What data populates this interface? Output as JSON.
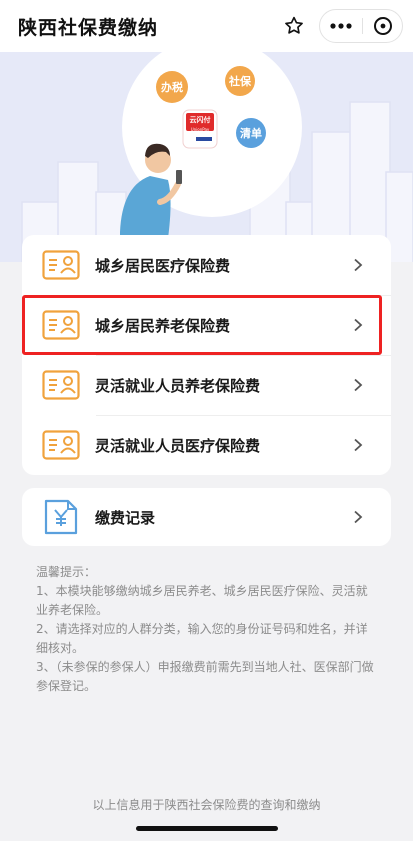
{
  "header": {
    "title": "陕西社保费缴纳",
    "favorite_icon": "star-icon",
    "more_icon": "more-dots-icon",
    "close_icon": "close-circle-icon"
  },
  "banner": {
    "bubbles": [
      "办税",
      "社保",
      "清单"
    ],
    "app_logo_text": "云闪付",
    "app_logo_sub": "UnionPay",
    "colors": {
      "background": "#e6e9f8",
      "bubble_orange": "#f2a74b",
      "bubble_blue": "#5aa0dd",
      "logo_red": "#e02b2b"
    }
  },
  "services": [
    {
      "label": "城乡居民医疗保险费",
      "icon": "id-card-icon",
      "highlighted": false
    },
    {
      "label": "城乡居民养老保险费",
      "icon": "id-card-icon",
      "highlighted": true
    },
    {
      "label": "灵活就业人员养老保险费",
      "icon": "id-card-icon",
      "highlighted": false
    },
    {
      "label": "灵活就业人员医疗保险费",
      "icon": "id-card-icon",
      "highlighted": false
    }
  ],
  "record": {
    "label": "缴费记录",
    "icon": "payment-record-icon"
  },
  "tips": {
    "heading": "温馨提示：",
    "items": [
      "1、本模块能够缴纳城乡居民养老、城乡居民医疗保险、灵活就业养老保险。",
      "2、请选择对应的人群分类，输入您的身份证号码和姓名，并详细核对。",
      "3、（未参保的参保人）申报缴费前需先到当地人社、医保部门做参保登记。"
    ]
  },
  "footer": {
    "text": "以上信息用于陕西社会保险费的查询和缴纳"
  },
  "accent": {
    "icon_orange": "#f0a23c",
    "highlight_red": "#ee2222"
  }
}
